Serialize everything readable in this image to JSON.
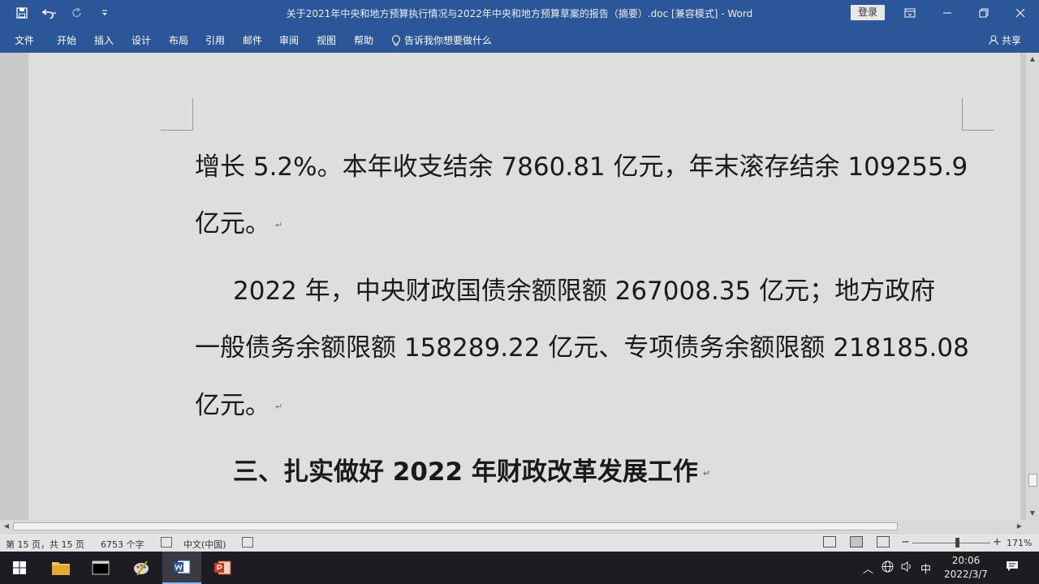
{
  "window": {
    "title": "关于2021年中央和地方预算执行情况与2022年中央和地方预算草案的报告（摘要）.doc [兼容模式] - Word",
    "login_label": "登录"
  },
  "qat": {
    "save_icon": "save-icon",
    "undo_icon": "undo-icon",
    "redo_icon": "redo-icon",
    "customize_icon": "customize-icon"
  },
  "ribbon": {
    "tabs": [
      "文件",
      "开始",
      "插入",
      "设计",
      "布局",
      "引用",
      "邮件",
      "审阅",
      "视图",
      "帮助"
    ],
    "tell_me": "告诉我你想要做什么",
    "share": "共享"
  },
  "document": {
    "lines": [
      "增长 5.2%。本年收支结余 7860.81 亿元，年末滚存结余 109255.9",
      "亿元。",
      "2022 年，中央财政国债余额限额 267008.35 亿元；地方政府",
      "一般债务余额限额 158289.22 亿元、专项债务余额限额 218185.08",
      "亿元。",
      "三、扎实做好 2022 年财政改革发展工作"
    ],
    "paragraph_mark": "↵"
  },
  "statusbar": {
    "page": "第 15 页，共 15 页",
    "words": "6753 个字",
    "language": "中文(中国)",
    "zoom_minus": "−",
    "zoom_plus": "+",
    "zoom": "171%"
  },
  "taskbar": {
    "ime": "中",
    "time": "20:06",
    "date": "2022/3/7"
  },
  "colors": {
    "ribbon": "#2b579a",
    "page": "#dedede",
    "taskbar": "#1c1c22"
  }
}
